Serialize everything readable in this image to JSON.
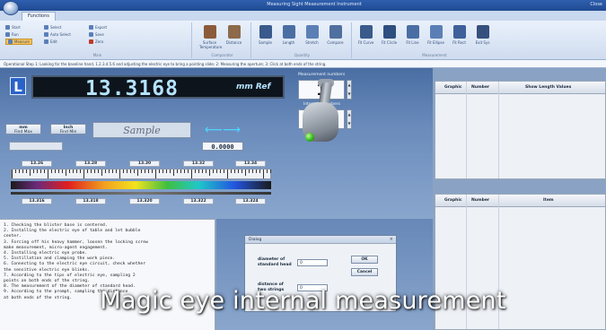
{
  "window": {
    "title": "Measuring Sight Measurement Instrument",
    "controls": "Close"
  },
  "ribbon": {
    "tab": "Functions",
    "left_group": {
      "title": "Main",
      "items": [
        "Start",
        "Run",
        "Select",
        "Auto Select",
        "Edit",
        "Export",
        "Save",
        "Measure",
        "Zero"
      ],
      "active_item": "Measure"
    },
    "big_buttons": [
      "Surface Temperature",
      "Distance",
      "Sample",
      "Length",
      "Stretch",
      "Compare",
      "Fit Curve",
      "Fit Circle",
      "Fit Line",
      "Fit Ellipse",
      "Fit Rect",
      "Exit Sys"
    ],
    "group_titles": [
      "Comparator",
      "Quantity",
      "Measurement"
    ]
  },
  "status_line": "Operational Step 1: Looking for the baseline hand, 1.2.3.4.5.6 and adjusting the electric eye to bring a pointing slide; 2: Measuring the aperture; 3: Click at both ends of the string.",
  "display": {
    "unit_badge": "L",
    "value": "13.3168",
    "unit": "mm Ref",
    "measurement_numbers_label": "Measurement numbers",
    "measurement_number": "1",
    "intervals_label": "Intervals numbers",
    "interval_number": "4",
    "buttons": [
      {
        "line1": "mm",
        "line2": "Find Max"
      },
      {
        "line1": "Inch",
        "line2": "Find Min"
      }
    ],
    "sample_label": "Sample",
    "readout": "0.0000",
    "arrows": "⟵⟶",
    "scale_top": [
      "13.26",
      "13.28",
      "13.30",
      "13.32",
      "13.34"
    ],
    "scale_bottom": [
      "13.316",
      "13.318",
      "13.320",
      "13.322",
      "13.324"
    ]
  },
  "right_top_table": {
    "columns": [
      "Graphic",
      "Number",
      "Show Length Values"
    ]
  },
  "right_bottom_table": {
    "columns": [
      "Graphic",
      "Number",
      "Item"
    ]
  },
  "steps": [
    "1. Checking the blister base is centered.",
    "2. Installing the electric eye of table and let bubble",
    "   center.",
    "3. Forcing off his heavy hammer, loosen the locking screw",
    "   make measurement, micro-agent engagement.",
    "4. Installing electric eye probe.",
    "5. Instillation and clamping the work piece.",
    "6. Connecting to the electric eye circuit, check whether",
    "   the sensitive electric eye blinks.",
    "7. According to the tips of electric eye, sampling 2",
    "   points on both ends of the string.",
    "8. The measurement of the diameter of standard head.",
    "9. According to the prompt, sampling the distance",
    "   at both ends of the string."
  ],
  "dialog": {
    "title": "Dialog",
    "close": "×",
    "fields": [
      {
        "label_1": "diameter of",
        "label_2": "standard head",
        "value": "0"
      },
      {
        "label_1": "distance of",
        "label_2": "two strings",
        "value": "0"
      }
    ],
    "ok": "OK",
    "cancel": "Cancel"
  },
  "caption": "Magic eye internal measurement"
}
